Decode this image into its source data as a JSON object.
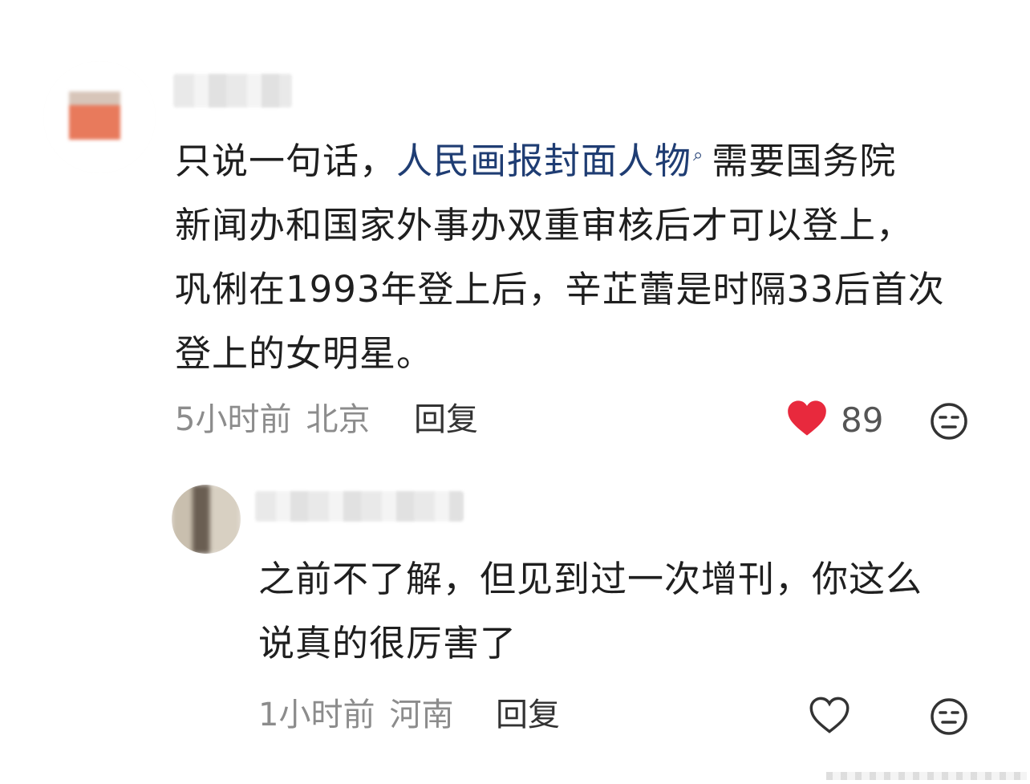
{
  "comments": [
    {
      "text_before": "只说一句话，",
      "link_text": "人民画报封面人物",
      "text_after_line1": "需要国务院",
      "line2": "新闻办和国家外事办双重审核后才可以登上，",
      "line3": "巩俐在1993年登上后，辛芷蕾是时隔33后首次",
      "line4": "登上的女明星。",
      "time": "5小时前",
      "location": "北京",
      "reply_label": "回复",
      "likes": "89",
      "liked": true
    },
    {
      "line1": "之前不了解，但见到过一次增刊，你这么",
      "line2": "说真的很厉害了",
      "time": "1小时前",
      "location": "河南",
      "reply_label": "回复",
      "liked": false
    }
  ],
  "colors": {
    "link": "#1f3d73",
    "heart_liked": "#e8293d",
    "meta_gray": "#8c8c8c"
  },
  "icons": {
    "search_mark": "search-icon",
    "like": "heart-icon",
    "reaction": "neutral-face-icon"
  }
}
